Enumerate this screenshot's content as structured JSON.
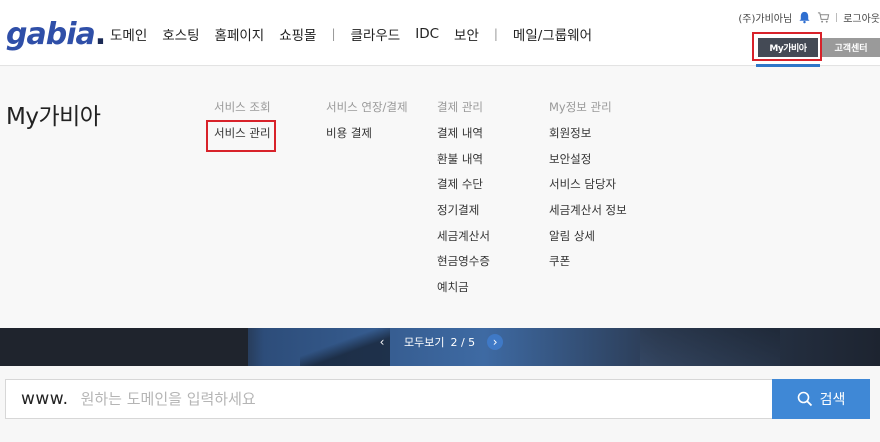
{
  "header": {
    "logo": "gabia",
    "gnb": [
      "도메인",
      "호스팅",
      "홈페이지",
      "쇼핑몰",
      "클라우드",
      "IDC",
      "보안",
      "메일/그룹웨어"
    ],
    "username": "(주)가비아님",
    "logout": "로그아웃",
    "mygabia_button": "My가비아",
    "support_button": "고객센터"
  },
  "mega_menu": {
    "title": "My가비아",
    "columns": [
      {
        "heading": "서비스 조회",
        "links": [
          "서비스 관리"
        ]
      },
      {
        "heading": "서비스 연장/결제",
        "links": [
          "비용 결제"
        ]
      },
      {
        "heading": "결제 관리",
        "links": [
          "결제 내역",
          "환불 내역",
          "결제 수단",
          "정기결제",
          "세금계산서",
          "현금영수증",
          "예치금"
        ]
      },
      {
        "heading": "My정보 관리",
        "links": [
          "회원정보",
          "보안설정",
          "서비스 담당자",
          "세금계산서 정보",
          "알림 상세",
          "쿠폰"
        ]
      }
    ]
  },
  "banner": {
    "view_all": "모두보기",
    "page": "2 / 5"
  },
  "search": {
    "prefix": "www.",
    "placeholder": "원하는 도메인을 입력하세요",
    "button": "검색"
  },
  "colors": {
    "brand": "#2f4fa8",
    "accent_blue": "#3f88d6",
    "highlight_red": "#d8222a"
  }
}
